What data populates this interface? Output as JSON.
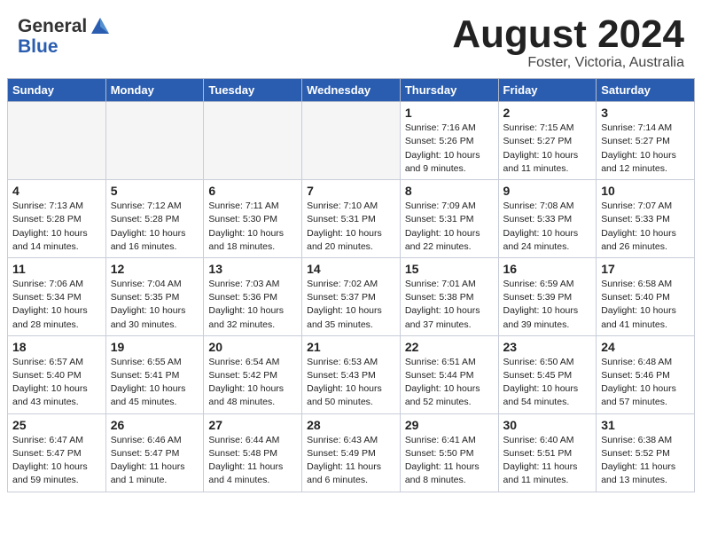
{
  "header": {
    "logo_general": "General",
    "logo_blue": "Blue",
    "month_title": "August 2024",
    "location": "Foster, Victoria, Australia"
  },
  "calendar": {
    "days_of_week": [
      "Sunday",
      "Monday",
      "Tuesday",
      "Wednesday",
      "Thursday",
      "Friday",
      "Saturday"
    ],
    "weeks": [
      [
        {
          "day": "",
          "info": ""
        },
        {
          "day": "",
          "info": ""
        },
        {
          "day": "",
          "info": ""
        },
        {
          "day": "",
          "info": ""
        },
        {
          "day": "1",
          "info": "Sunrise: 7:16 AM\nSunset: 5:26 PM\nDaylight: 10 hours\nand 9 minutes."
        },
        {
          "day": "2",
          "info": "Sunrise: 7:15 AM\nSunset: 5:27 PM\nDaylight: 10 hours\nand 11 minutes."
        },
        {
          "day": "3",
          "info": "Sunrise: 7:14 AM\nSunset: 5:27 PM\nDaylight: 10 hours\nand 12 minutes."
        }
      ],
      [
        {
          "day": "4",
          "info": "Sunrise: 7:13 AM\nSunset: 5:28 PM\nDaylight: 10 hours\nand 14 minutes."
        },
        {
          "day": "5",
          "info": "Sunrise: 7:12 AM\nSunset: 5:28 PM\nDaylight: 10 hours\nand 16 minutes."
        },
        {
          "day": "6",
          "info": "Sunrise: 7:11 AM\nSunset: 5:30 PM\nDaylight: 10 hours\nand 18 minutes."
        },
        {
          "day": "7",
          "info": "Sunrise: 7:10 AM\nSunset: 5:31 PM\nDaylight: 10 hours\nand 20 minutes."
        },
        {
          "day": "8",
          "info": "Sunrise: 7:09 AM\nSunset: 5:31 PM\nDaylight: 10 hours\nand 22 minutes."
        },
        {
          "day": "9",
          "info": "Sunrise: 7:08 AM\nSunset: 5:33 PM\nDaylight: 10 hours\nand 24 minutes."
        },
        {
          "day": "10",
          "info": "Sunrise: 7:07 AM\nSunset: 5:33 PM\nDaylight: 10 hours\nand 26 minutes."
        }
      ],
      [
        {
          "day": "11",
          "info": "Sunrise: 7:06 AM\nSunset: 5:34 PM\nDaylight: 10 hours\nand 28 minutes."
        },
        {
          "day": "12",
          "info": "Sunrise: 7:04 AM\nSunset: 5:35 PM\nDaylight: 10 hours\nand 30 minutes."
        },
        {
          "day": "13",
          "info": "Sunrise: 7:03 AM\nSunset: 5:36 PM\nDaylight: 10 hours\nand 32 minutes."
        },
        {
          "day": "14",
          "info": "Sunrise: 7:02 AM\nSunset: 5:37 PM\nDaylight: 10 hours\nand 35 minutes."
        },
        {
          "day": "15",
          "info": "Sunrise: 7:01 AM\nSunset: 5:38 PM\nDaylight: 10 hours\nand 37 minutes."
        },
        {
          "day": "16",
          "info": "Sunrise: 6:59 AM\nSunset: 5:39 PM\nDaylight: 10 hours\nand 39 minutes."
        },
        {
          "day": "17",
          "info": "Sunrise: 6:58 AM\nSunset: 5:40 PM\nDaylight: 10 hours\nand 41 minutes."
        }
      ],
      [
        {
          "day": "18",
          "info": "Sunrise: 6:57 AM\nSunset: 5:40 PM\nDaylight: 10 hours\nand 43 minutes."
        },
        {
          "day": "19",
          "info": "Sunrise: 6:55 AM\nSunset: 5:41 PM\nDaylight: 10 hours\nand 45 minutes."
        },
        {
          "day": "20",
          "info": "Sunrise: 6:54 AM\nSunset: 5:42 PM\nDaylight: 10 hours\nand 48 minutes."
        },
        {
          "day": "21",
          "info": "Sunrise: 6:53 AM\nSunset: 5:43 PM\nDaylight: 10 hours\nand 50 minutes."
        },
        {
          "day": "22",
          "info": "Sunrise: 6:51 AM\nSunset: 5:44 PM\nDaylight: 10 hours\nand 52 minutes."
        },
        {
          "day": "23",
          "info": "Sunrise: 6:50 AM\nSunset: 5:45 PM\nDaylight: 10 hours\nand 54 minutes."
        },
        {
          "day": "24",
          "info": "Sunrise: 6:48 AM\nSunset: 5:46 PM\nDaylight: 10 hours\nand 57 minutes."
        }
      ],
      [
        {
          "day": "25",
          "info": "Sunrise: 6:47 AM\nSunset: 5:47 PM\nDaylight: 10 hours\nand 59 minutes."
        },
        {
          "day": "26",
          "info": "Sunrise: 6:46 AM\nSunset: 5:47 PM\nDaylight: 11 hours\nand 1 minute."
        },
        {
          "day": "27",
          "info": "Sunrise: 6:44 AM\nSunset: 5:48 PM\nDaylight: 11 hours\nand 4 minutes."
        },
        {
          "day": "28",
          "info": "Sunrise: 6:43 AM\nSunset: 5:49 PM\nDaylight: 11 hours\nand 6 minutes."
        },
        {
          "day": "29",
          "info": "Sunrise: 6:41 AM\nSunset: 5:50 PM\nDaylight: 11 hours\nand 8 minutes."
        },
        {
          "day": "30",
          "info": "Sunrise: 6:40 AM\nSunset: 5:51 PM\nDaylight: 11 hours\nand 11 minutes."
        },
        {
          "day": "31",
          "info": "Sunrise: 6:38 AM\nSunset: 5:52 PM\nDaylight: 11 hours\nand 13 minutes."
        }
      ]
    ]
  }
}
